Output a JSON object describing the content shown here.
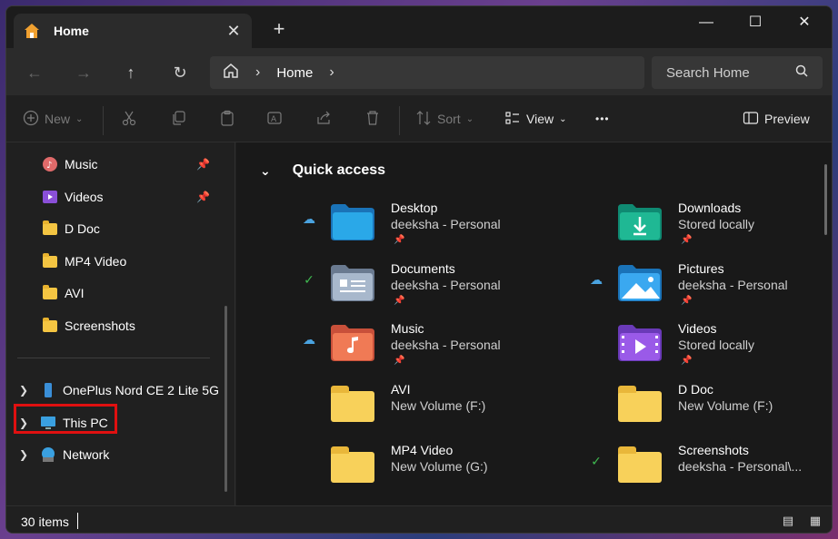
{
  "tab": {
    "label": "Home",
    "close_label": "✕",
    "new_tab_label": "+"
  },
  "window_controls": {
    "minimize": "—",
    "maximize": "☐",
    "close": "✕"
  },
  "nav": {
    "back": "←",
    "forward": "→",
    "up": "↑",
    "refresh": "↻"
  },
  "address": {
    "sep1": "›",
    "location": "Home",
    "sep2": "›"
  },
  "search": {
    "placeholder": "Search Home"
  },
  "commands": {
    "new_label": "New",
    "sort_label": "Sort",
    "view_label": "View",
    "more_label": "•••",
    "preview_label": "Preview"
  },
  "sidebar": {
    "pinned": [
      {
        "label": "Music",
        "pinned": true
      },
      {
        "label": "Videos",
        "pinned": true
      },
      {
        "label": "D Doc"
      },
      {
        "label": "MP4 Video"
      },
      {
        "label": "AVI"
      },
      {
        "label": "Screenshots"
      }
    ],
    "devices": [
      {
        "label": "OnePlus Nord CE 2 Lite 5G"
      },
      {
        "label": "This PC"
      },
      {
        "label": "Network"
      }
    ]
  },
  "quick_access": {
    "title": "Quick access",
    "items": [
      {
        "name": "Desktop",
        "sub": "deeksha - Personal",
        "status": "cloud",
        "pinned": true
      },
      {
        "name": "Downloads",
        "sub": "Stored locally",
        "status": "",
        "pinned": true
      },
      {
        "name": "Documents",
        "sub": "deeksha - Personal",
        "status": "check",
        "pinned": true
      },
      {
        "name": "Pictures",
        "sub": "deeksha - Personal",
        "status": "cloud",
        "pinned": true
      },
      {
        "name": "Music",
        "sub": "deeksha - Personal",
        "status": "cloud",
        "pinned": true
      },
      {
        "name": "Videos",
        "sub": "Stored locally",
        "status": "",
        "pinned": true
      },
      {
        "name": "AVI",
        "sub": "New Volume (F:)",
        "status": ""
      },
      {
        "name": "D Doc",
        "sub": "New Volume (F:)",
        "status": ""
      },
      {
        "name": "MP4 Video",
        "sub": "New Volume (G:)",
        "status": ""
      },
      {
        "name": "Screenshots",
        "sub": "deeksha - Personal\\...",
        "status": "check"
      }
    ]
  },
  "status": {
    "item_count": "30 items"
  },
  "colors": {
    "accent_cloud": "#4aa3e0",
    "check_green": "#3fb950",
    "highlight_red": "#e01010"
  }
}
